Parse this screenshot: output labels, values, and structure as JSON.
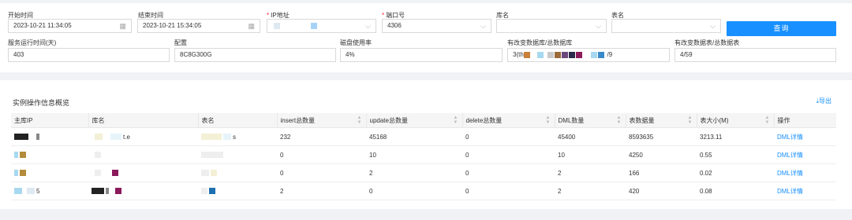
{
  "filters": {
    "start_time": {
      "label": "开始时间",
      "value": "2023-10-21 11:34:05"
    },
    "end_time": {
      "label": "结束时间",
      "value": "2023-10-21 15:34:05"
    },
    "ip": {
      "label": "IP地址",
      "value": ""
    },
    "port": {
      "label": "端口号",
      "value": "4306"
    },
    "db": {
      "label": "库名",
      "value": ""
    },
    "table": {
      "label": "表名",
      "value": ""
    },
    "query_button": "查询"
  },
  "stats": {
    "uptime": {
      "label": "服务运行时间(天)",
      "value": "403"
    },
    "config": {
      "label": "配置",
      "value": "8C8G300G"
    },
    "disk": {
      "label": "磁盘使用率",
      "value": "4%"
    },
    "changed_dbs": {
      "label": "有改变数据库/总数据库",
      "prefix": "3(th",
      "suffix": "/9"
    },
    "changed_tables": {
      "label": "有改变数据表/总数据表",
      "value": "4/59"
    }
  },
  "overview": {
    "title": "实例操作信息概览",
    "export_label": "导出",
    "columns": [
      "主库IP",
      "库名",
      "表名",
      "insert总数量",
      "update总数量",
      "delete总数量",
      "DML数量",
      "表数据量",
      "表大小(M)",
      "操作"
    ],
    "rows": [
      {
        "ip_tail": "",
        "db_tail": "t.e",
        "table_tail": "s",
        "insert": "232",
        "update": "45168",
        "delete": "0",
        "dml": "45400",
        "rows": "8593635",
        "size": "3213.11",
        "action": "DML详情"
      },
      {
        "ip_tail": "",
        "db_tail": "",
        "table_tail": "",
        "insert": "0",
        "update": "10",
        "delete": "0",
        "dml": "10",
        "rows": "4250",
        "size": "0.55",
        "action": "DML详情"
      },
      {
        "ip_tail": "",
        "db_tail": "",
        "table_tail": "",
        "insert": "0",
        "update": "2",
        "delete": "0",
        "dml": "2",
        "rows": "166",
        "size": "0.02",
        "action": "DML详情"
      },
      {
        "ip_tail": "5",
        "db_tail": "",
        "table_tail": "",
        "insert": "2",
        "update": "0",
        "delete": "0",
        "dml": "2",
        "rows": "420",
        "size": "0.08",
        "action": "DML详情"
      }
    ]
  },
  "colors": {
    "accent": "#1890ff",
    "required": "#f5222d"
  }
}
